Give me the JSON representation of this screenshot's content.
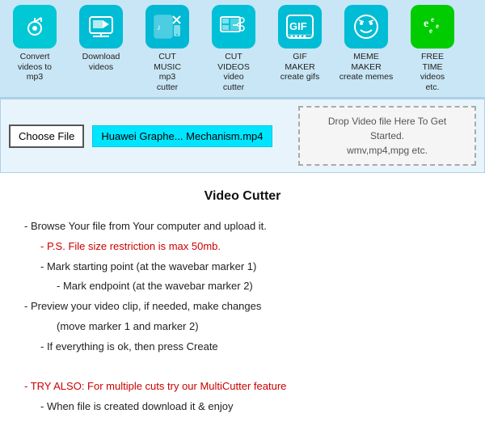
{
  "nav": {
    "items": [
      {
        "id": "convert-mp3",
        "label": "Convert\nvideos to\nmp3",
        "icon_class": "icon-mp3",
        "icon_symbol": "♪",
        "icon_color": "#00c8d4"
      },
      {
        "id": "download-videos",
        "label": "Download\nvideos",
        "icon_class": "icon-download",
        "icon_symbol": "🎬",
        "icon_color": "#00bcd4"
      },
      {
        "id": "cut-music",
        "label": "CUT\nMUSIC\nmp3\ncutter",
        "icon_class": "icon-cut-music",
        "icon_symbol": "📱",
        "icon_color": "#00b8d4"
      },
      {
        "id": "cut-videos",
        "label": "CUT\nVIDEOS\nvideo\ncutter",
        "icon_class": "icon-cut-video",
        "icon_symbol": "✂",
        "icon_color": "#00c0d8"
      },
      {
        "id": "gif-maker",
        "label": "GIF\nMAKER\ncreate gifs",
        "icon_class": "icon-gif",
        "icon_symbol": "GIF",
        "icon_color": "#00bcd4"
      },
      {
        "id": "meme-maker",
        "label": "MEME\nMAKER\ncreate memes",
        "icon_class": "icon-meme",
        "icon_symbol": "😊",
        "icon_color": "#00bcd4"
      },
      {
        "id": "free-time",
        "label": "FREE\nTIME\nvideos\netc.",
        "icon_class": "icon-free",
        "icon_symbol": "e",
        "icon_color": "#00cc00"
      }
    ]
  },
  "file_area": {
    "choose_btn": "Choose File",
    "file_name": "Huawei Graphe... Mechanism.mp4",
    "drop_text": "Drop Video file Here To Get Started.\nwmv,mp4,mpg etc."
  },
  "main": {
    "title": "Video Cutter",
    "instructions": [
      {
        "text": "- Browse Your file from Your computer and upload it.",
        "class": ""
      },
      {
        "text": "- P.S. File size restriction is max 50mb.",
        "class": "red indent1"
      },
      {
        "text": "- Mark starting point (at the wavebar marker 1)",
        "class": "indent1"
      },
      {
        "text": "- Mark endpoint (at the wavebar marker 2)",
        "class": "indent2"
      },
      {
        "text": "- Preview your video clip, if needed, make changes",
        "class": ""
      },
      {
        "text": "(move marker 1 and marker 2)",
        "class": "indent2"
      },
      {
        "text": "- If everything is ok, then press Create",
        "class": "indent1"
      }
    ],
    "try_also": "- TRY ALSO: For multiple cuts try our MultiCutter feature",
    "last_line": "- When file is created download it & enjoy"
  }
}
